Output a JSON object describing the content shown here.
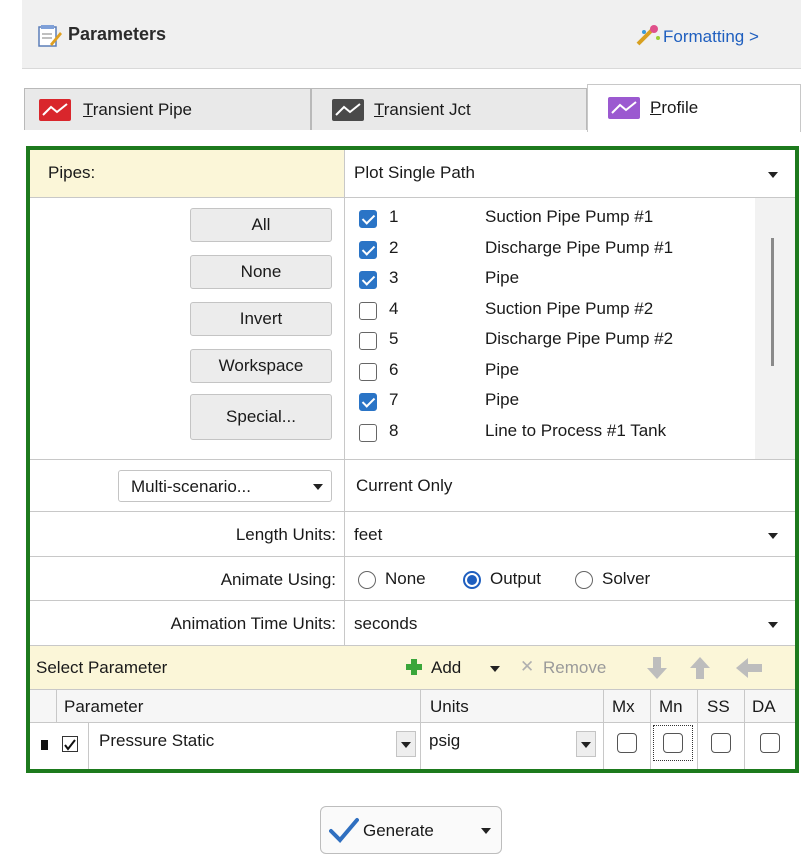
{
  "header": {
    "title": "Parameters",
    "formatting_link": "Formatting >"
  },
  "tabs": [
    {
      "label": "Transient Pipe",
      "accel": "T",
      "rest": "ransient Pipe",
      "color": "#d9262c",
      "active": false
    },
    {
      "label": "Transient Jct",
      "accel": "T",
      "rest": "ransient Jct",
      "color": "#4a4a4a",
      "active": false
    },
    {
      "label": "Profile",
      "accel": "P",
      "rest": "rofile",
      "color": "#9b59d0",
      "active": true
    }
  ],
  "pipes": {
    "label": "Pipes:",
    "mode": "Plot Single Path",
    "buttons": {
      "all": "All",
      "none": "None",
      "invert": "Invert",
      "workspace": "Workspace",
      "special": "Special..."
    },
    "items": [
      {
        "num": "1",
        "name": "Suction Pipe Pump #1",
        "checked": true
      },
      {
        "num": "2",
        "name": "Discharge Pipe Pump #1",
        "checked": true
      },
      {
        "num": "3",
        "name": "Pipe",
        "checked": true
      },
      {
        "num": "4",
        "name": "Suction Pipe Pump #2",
        "checked": false
      },
      {
        "num": "5",
        "name": "Discharge Pipe Pump #2",
        "checked": false
      },
      {
        "num": "6",
        "name": "Pipe",
        "checked": false
      },
      {
        "num": "7",
        "name": "Pipe",
        "checked": true
      },
      {
        "num": "8",
        "name": "Line to Process #1 Tank",
        "checked": false
      }
    ]
  },
  "scenario": {
    "button": "Multi-scenario...",
    "value": "Current Only"
  },
  "length_units": {
    "label": "Length Units:",
    "value": "feet"
  },
  "animate": {
    "label": "Animate Using:",
    "options": [
      "None",
      "Output",
      "Solver"
    ],
    "selected": "Output"
  },
  "anim_time": {
    "label": "Animation Time Units:",
    "value": "seconds"
  },
  "select_param": {
    "label": "Select Parameter",
    "add": "Add",
    "remove": "Remove"
  },
  "param_table": {
    "headers": {
      "parameter": "Parameter",
      "units": "Units",
      "mx": "Mx",
      "mn": "Mn",
      "ss": "SS",
      "da": "DA"
    },
    "rows": [
      {
        "parameter": "Pressure Static",
        "units": "psig",
        "checked": true
      }
    ]
  },
  "generate": {
    "label": "Generate"
  }
}
